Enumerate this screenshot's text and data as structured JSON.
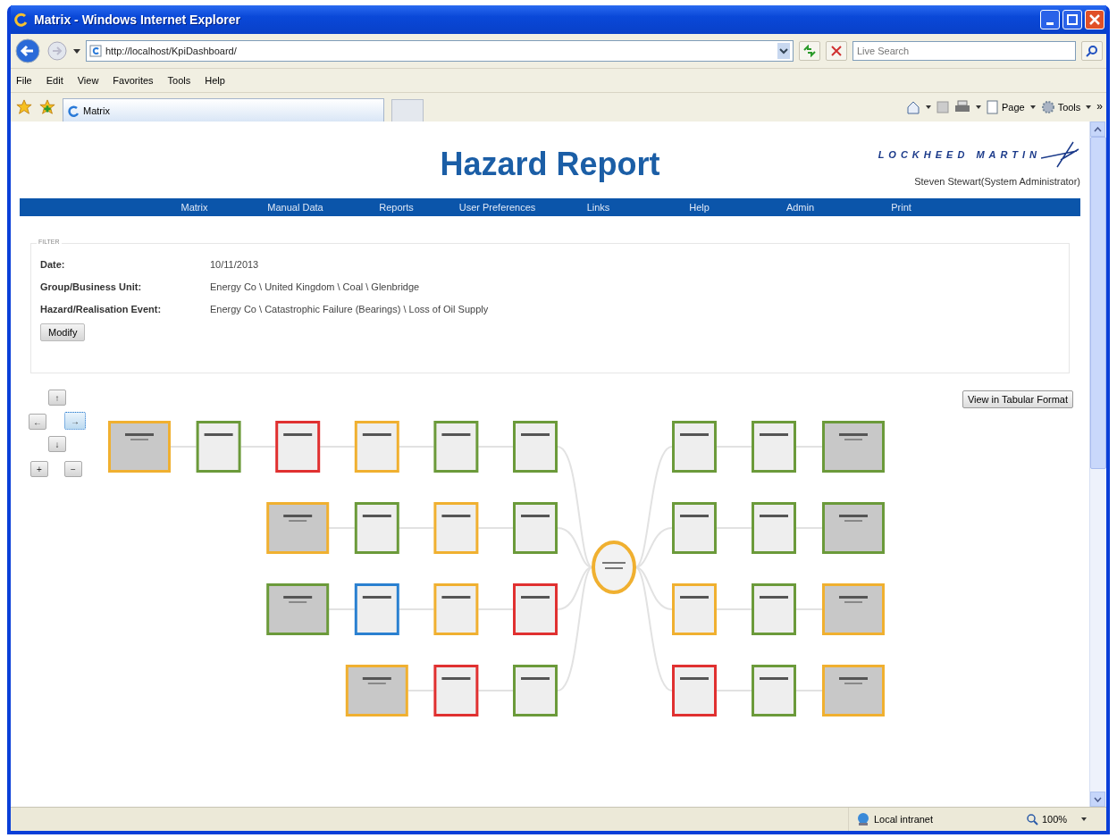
{
  "window": {
    "title": "Matrix - Windows Internet Explorer"
  },
  "address_bar": {
    "url": "http://localhost/KpiDashboard/"
  },
  "search": {
    "placeholder": "Live Search"
  },
  "menu": [
    "File",
    "Edit",
    "View",
    "Favorites",
    "Tools",
    "Help"
  ],
  "tab": {
    "title": "Matrix"
  },
  "command_bar": {
    "items": [
      "Page",
      "Tools"
    ],
    "more": "»"
  },
  "page": {
    "title": "Hazard Report",
    "logo": "LOCKHEED MARTIN",
    "user": "Steven Stewart(System Administrator)",
    "nav": [
      "Matrix",
      "Manual Data",
      "Reports",
      "User Preferences",
      "Links",
      "Help",
      "Admin",
      "Print"
    ],
    "filter": {
      "legend": "FILTER",
      "rows": [
        {
          "label": "Date:",
          "value": "10/11/2013"
        },
        {
          "label": "Group/Business Unit:",
          "value": "Energy Co \\ United Kingdom \\ Coal \\ Glenbridge"
        },
        {
          "label": "Hazard/Realisation Event:",
          "value": "Energy Co \\ Catastrophic Failure (Bearings) \\ Loss of Oil Supply"
        }
      ],
      "button": "Modify"
    },
    "tabular_button": "View in Tabular Format",
    "pad": [
      {
        "label": "↑",
        "selected": false
      },
      {
        "label": "←",
        "selected": false
      },
      {
        "label": "→",
        "selected": true
      },
      {
        "label": "↓",
        "selected": false
      },
      {
        "label": "+",
        "selected": false
      },
      {
        "label": "−",
        "selected": false
      }
    ],
    "diagram": {
      "left": [
        [
          {
            "kind": "root",
            "color": "#f0b030"
          },
          {
            "kind": "step",
            "color": "#6b9a3a"
          },
          {
            "kind": "step",
            "color": "#e03030"
          },
          {
            "kind": "step",
            "color": "#f0b030"
          },
          {
            "kind": "step",
            "color": "#6b9a3a"
          },
          {
            "kind": "step",
            "color": "#6b9a3a"
          }
        ],
        [
          {
            "kind": "root",
            "color": "#f0b030"
          },
          {
            "kind": "step",
            "color": "#6b9a3a"
          },
          {
            "kind": "step",
            "color": "#f0b030"
          },
          {
            "kind": "step",
            "color": "#6b9a3a"
          }
        ],
        [
          {
            "kind": "root",
            "color": "#6b9a3a"
          },
          {
            "kind": "step",
            "color": "#2a80d0"
          },
          {
            "kind": "step",
            "color": "#f0b030"
          },
          {
            "kind": "step",
            "color": "#e03030"
          }
        ],
        [
          {
            "kind": "root",
            "color": "#f0b030"
          },
          {
            "kind": "step",
            "color": "#e03030"
          },
          {
            "kind": "step",
            "color": "#6b9a3a"
          }
        ]
      ],
      "center": {
        "color": "#f0b030"
      },
      "right": [
        [
          {
            "kind": "step",
            "color": "#6b9a3a"
          },
          {
            "kind": "step",
            "color": "#6b9a3a"
          },
          {
            "kind": "root",
            "color": "#6b9a3a"
          }
        ],
        [
          {
            "kind": "step",
            "color": "#6b9a3a"
          },
          {
            "kind": "step",
            "color": "#6b9a3a"
          },
          {
            "kind": "root",
            "color": "#6b9a3a"
          }
        ],
        [
          {
            "kind": "step",
            "color": "#f0b030"
          },
          {
            "kind": "step",
            "color": "#6b9a3a"
          },
          {
            "kind": "root",
            "color": "#f0b030"
          }
        ],
        [
          {
            "kind": "step",
            "color": "#e03030"
          },
          {
            "kind": "step",
            "color": "#6b9a3a"
          },
          {
            "kind": "root",
            "color": "#f0b030"
          }
        ]
      ]
    }
  },
  "status_bar": {
    "zone": "Local intranet",
    "zoom": "100%"
  }
}
